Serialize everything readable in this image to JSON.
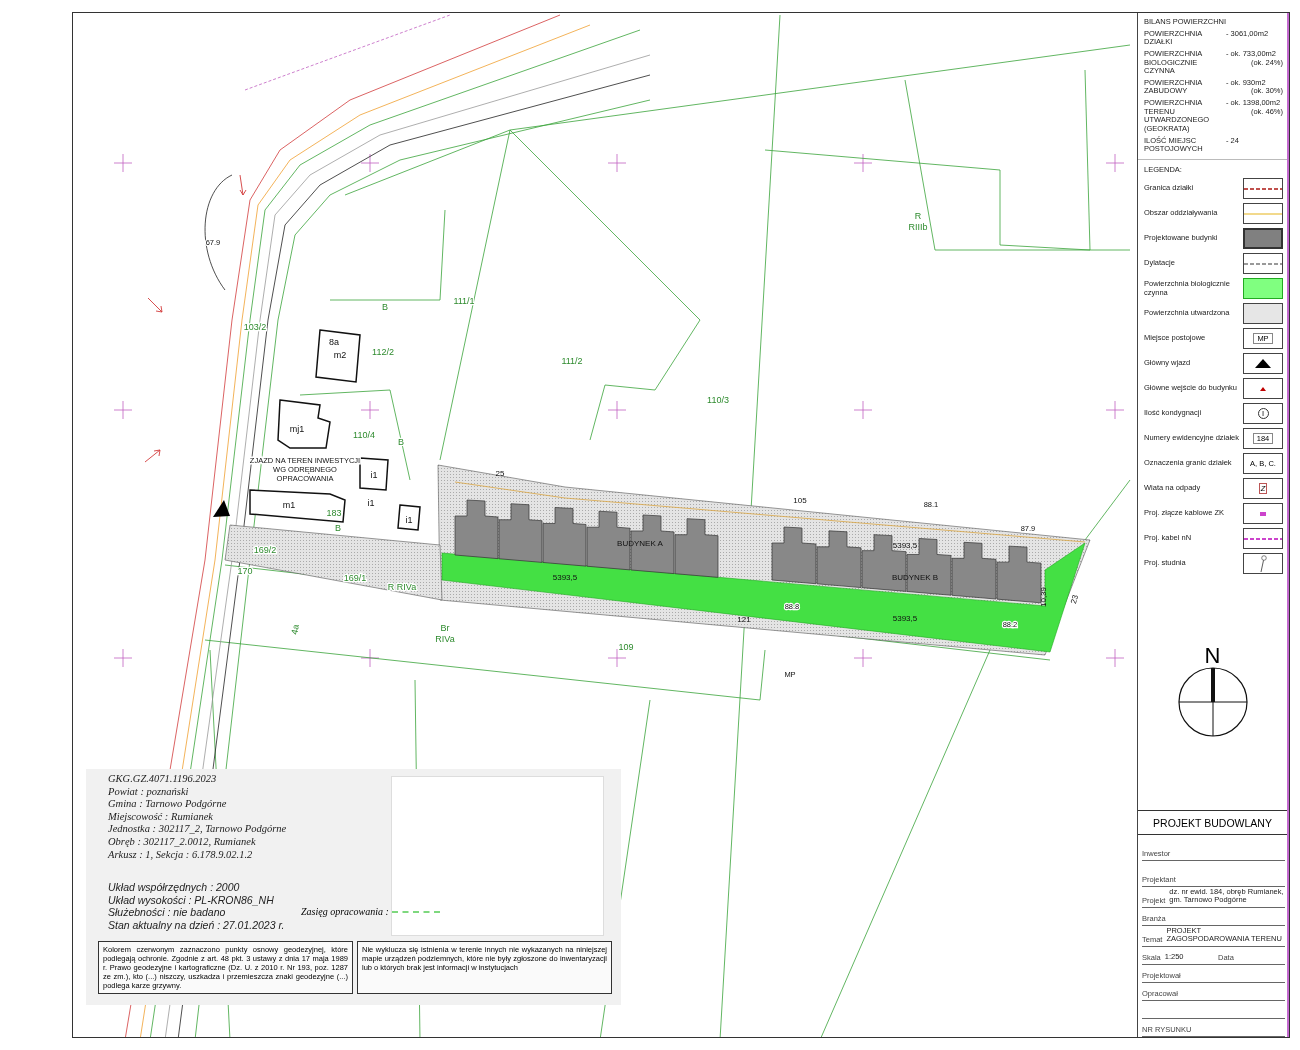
{
  "surface_balance": {
    "title": "BILANS POWIERZCHNI",
    "rows": [
      {
        "label": "POWIERZCHNIA DZIAŁKI",
        "value": "- 3061,00m2"
      },
      {
        "label": "POWIERZCHNIA BIOLOGICZNIE CZYNNA",
        "value": "- ok. 733,00m2",
        "note": "(ok. 24%)"
      },
      {
        "label": "POWIERZCHNIA ZABUDOWY",
        "value": "- ok. 930m2",
        "note": "(ok. 30%)"
      },
      {
        "label": "POWIERZCHNIA TERENU UTWARDZONEGO (GEOKRATA)",
        "value": "- ok. 1398,00m2",
        "note": "(ok. 46%)"
      },
      {
        "label": "ILOŚĆ MIEJSC POSTOJOWYCH",
        "value": "- 24"
      }
    ]
  },
  "legend": {
    "title": "LEGENDA:",
    "items": [
      {
        "label": "Granica działki",
        "kind": "dashed-line",
        "color": "#c0504d"
      },
      {
        "label": "Obszar oddziaływania",
        "kind": "line",
        "color": "#f2d98c"
      },
      {
        "label": "Projektowane budynki",
        "kind": "fill",
        "color": "#808080"
      },
      {
        "label": "Dylatacje",
        "kind": "dashed-line",
        "color": "#999999"
      },
      {
        "label": "Powierzchnia biologicznie czynna",
        "kind": "fill",
        "color": "#80ff80"
      },
      {
        "label": "Powierzchnia utwardzona",
        "kind": "hatch"
      },
      {
        "label": "Miejsce postojowe",
        "kind": "tag",
        "symbol": "MP"
      },
      {
        "label": "Główny wjazd",
        "kind": "triangle",
        "color": "#000000"
      },
      {
        "label": "Główne wejście do budynku",
        "kind": "small-triangle",
        "color": "#c00000"
      },
      {
        "label": "Ilość kondygnacji",
        "kind": "circle",
        "symbol": "I"
      },
      {
        "label": "Numery ewidencyjne działek",
        "kind": "tag",
        "symbol": "184"
      },
      {
        "label": "Oznaczenia granic działek",
        "kind": "text",
        "symbol": "A, B, C."
      },
      {
        "label": "Wiata na odpady",
        "kind": "bin",
        "symbol": "Z"
      },
      {
        "label": "Proj. złącze kablowe ZK",
        "kind": "small-rect",
        "color": "#cc44cc"
      },
      {
        "label": "Proj. kabel nN",
        "kind": "dashed-line",
        "color": "#cc44cc"
      },
      {
        "label": "Proj. studnia",
        "kind": "well"
      }
    ]
  },
  "compass": {
    "label": "N"
  },
  "map": {
    "access_note": [
      "ZJAZD NA TEREN INWESTYCJI",
      "WG ODRĘBNEGO",
      "OPRACOWANIA"
    ],
    "labels": [
      {
        "text": "103/2",
        "kind": "parcel"
      },
      {
        "text": "B",
        "kind": "land"
      },
      {
        "text": "111/1",
        "kind": "parcel"
      },
      {
        "text": "8a",
        "kind": "building"
      },
      {
        "text": "m2",
        "kind": "building"
      },
      {
        "text": "112/2",
        "kind": "parcel"
      },
      {
        "text": "111/2",
        "kind": "parcel"
      },
      {
        "text": "R",
        "kind": "land"
      },
      {
        "text": "RIIIb",
        "kind": "land"
      },
      {
        "text": "110/3",
        "kind": "parcel"
      },
      {
        "text": "mj1",
        "kind": "building"
      },
      {
        "text": "110/4",
        "kind": "parcel"
      },
      {
        "text": "B",
        "kind": "land"
      },
      {
        "text": "m1",
        "kind": "building"
      },
      {
        "text": "i1",
        "kind": "building"
      },
      {
        "text": "i1",
        "kind": "building"
      },
      {
        "text": "i1",
        "kind": "building"
      },
      {
        "text": "183",
        "kind": "parcel"
      },
      {
        "text": "B",
        "kind": "land"
      },
      {
        "text": "169/2",
        "kind": "parcel"
      },
      {
        "text": "170",
        "kind": "parcel"
      },
      {
        "text": "R RIVa",
        "kind": "land"
      },
      {
        "text": "169/1",
        "kind": "parcel"
      },
      {
        "text": "4a",
        "kind": "parcel"
      },
      {
        "text": "Br",
        "kind": "land"
      },
      {
        "text": "RIVa",
        "kind": "land"
      },
      {
        "text": "109",
        "kind": "parcel"
      },
      {
        "text": "25",
        "kind": "dimension"
      },
      {
        "text": "105",
        "kind": "dimension"
      },
      {
        "text": "5393,5",
        "kind": "dimension"
      },
      {
        "text": "BUDYNEK A",
        "kind": "caption"
      },
      {
        "text": "5393,5",
        "kind": "dimension"
      },
      {
        "text": "BUDYNEK B",
        "kind": "caption"
      },
      {
        "text": "5393,5",
        "kind": "dimension"
      },
      {
        "text": "121",
        "kind": "dimension"
      },
      {
        "text": "10,39",
        "kind": "dimension"
      },
      {
        "text": "23",
        "kind": "dimension"
      },
      {
        "text": "88.1",
        "kind": "elevation"
      },
      {
        "text": "87.9",
        "kind": "elevation"
      },
      {
        "text": "88.2",
        "kind": "elevation"
      },
      {
        "text": "88.8",
        "kind": "elevation"
      },
      {
        "text": "MP",
        "kind": "elevation"
      },
      {
        "text": "67.9",
        "kind": "elevation"
      }
    ]
  },
  "survey_info": {
    "lines": [
      "GKG.GZ.4071.1196.2023",
      "Powiat : poznański",
      "Gmina : Tarnowo Podgórne",
      "Miejscowość : Rumianek",
      "Jednostka : 302117_2, Tarnowo Podgórne",
      "Obręb : 302117_2.0012, Rumianek",
      "Arkusz : 1, Sekcja : 6.178.9.02.1.2"
    ],
    "lines_2": [
      "Układ współrzędnych : 2000",
      "Układ wysokości : PL-KRON86_NH",
      "Służebności : nie badano",
      "Stan aktualny na dzień : 27.01.2023 r."
    ],
    "range_label": "Zasięg opracowania :",
    "notes": [
      "Kolorem czerwonym zaznaczono punkty osnowy geodezyjnej, które podlegają ochronie. Zgodnie z art. 48 pkt. 3 ustawy z dnia 17 maja 1989 r. Prawo geodezyjne i kartograficzne (Dz. U. z 2010 r. Nr 193, poz. 1287 ze zm.), kto (...) niszczy, uszkadza i przemieszcza znaki geodezyjne (...) podlega karze grzywny.",
      "Nie wyklucza się istnienia w terenie innych nie wykazanych na niniejszej mapie urządzeń podziemnych, które nie były zgłoszone do inwentaryzacji lub o których brak jest informacji w instytucjach"
    ]
  },
  "title_block": {
    "heading": "PROJEKT BUDOWLANY",
    "rows": [
      [
        {
          "label": "Inwestor"
        }
      ],
      [
        {
          "label": "Projektant"
        }
      ],
      [
        {
          "label": "Projekt",
          "value": "dz. nr ewid. 184, obręb Rumianek, gm. Tarnowo Podgórne"
        }
      ],
      [
        {
          "label": "Branża"
        }
      ],
      [
        {
          "label": "Temat",
          "value": "PROJEKT ZAGOSPODAROWANIA TERENU"
        }
      ],
      [
        {
          "label": "Skala",
          "value": "1:250"
        },
        {
          "label": "Data"
        }
      ],
      [
        {
          "label": "Projektował"
        }
      ],
      [
        {
          "label": "Opracował"
        }
      ],
      [],
      [
        {
          "label": "NR RYSUNKU"
        }
      ]
    ]
  }
}
